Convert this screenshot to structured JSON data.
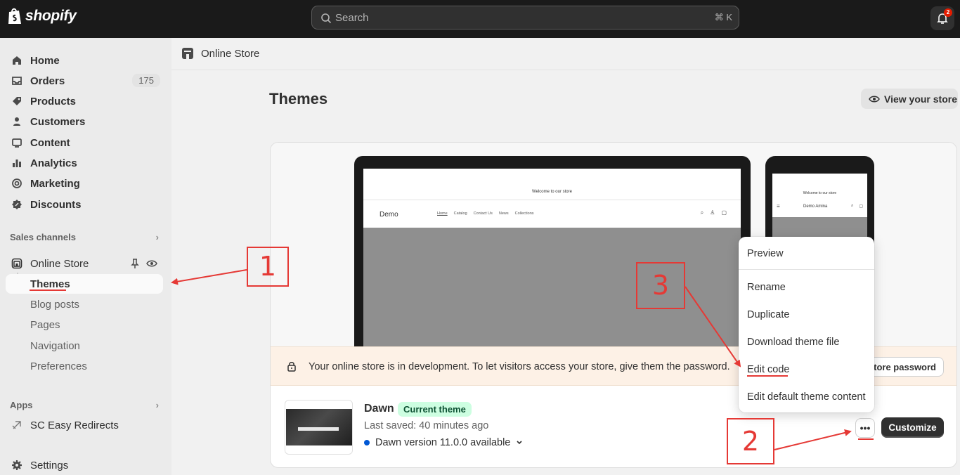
{
  "topbar": {
    "logo_text": "shopify",
    "search_placeholder": "Search",
    "search_shortcut": "⌘ K",
    "notification_count": "2"
  },
  "sidebar": {
    "items": [
      {
        "label": "Home",
        "icon": "home-icon"
      },
      {
        "label": "Orders",
        "icon": "inbox-icon",
        "count": "175"
      },
      {
        "label": "Products",
        "icon": "tag-icon"
      },
      {
        "label": "Customers",
        "icon": "person-icon"
      },
      {
        "label": "Content",
        "icon": "content-icon"
      },
      {
        "label": "Analytics",
        "icon": "bar-chart-icon"
      },
      {
        "label": "Marketing",
        "icon": "target-icon"
      },
      {
        "label": "Discounts",
        "icon": "discount-icon"
      }
    ],
    "sales_channels_heading": "Sales channels",
    "online_store": {
      "label": "Online Store",
      "sub_items": [
        "Themes",
        "Blog posts",
        "Pages",
        "Navigation",
        "Preferences"
      ]
    },
    "apps_heading": "Apps",
    "app_item": "SC Easy Redirects",
    "settings_label": "Settings"
  },
  "main": {
    "breadcrumb": "Online Store",
    "title": "Themes",
    "view_store_label": "View your store",
    "preview": {
      "announcement": "Welcome to our store",
      "logo": "Demo",
      "nav": [
        "Home",
        "Catalog",
        "Contact Us",
        "News",
        "Collections"
      ],
      "phone_logo": "Demo Amina"
    },
    "banner_text": "Your online store is in development. To let visitors access your store, give them the password.",
    "password_button": "tore password",
    "theme": {
      "name": "Dawn",
      "badge": "Current theme",
      "saved": "Last saved: 40 minutes ago",
      "version": "Dawn version 11.0.0 available"
    },
    "more_button": "•••",
    "customize_button": "Customize"
  },
  "dropdown": {
    "items": [
      "Preview",
      "Rename",
      "Duplicate",
      "Download theme file",
      "Edit code",
      "Edit default theme content"
    ]
  },
  "annotations": [
    "1",
    "2",
    "3"
  ],
  "colors": {
    "annotation": "#e53935",
    "topbar": "#1a1a1a",
    "badge_bg": "#cdfee1"
  }
}
